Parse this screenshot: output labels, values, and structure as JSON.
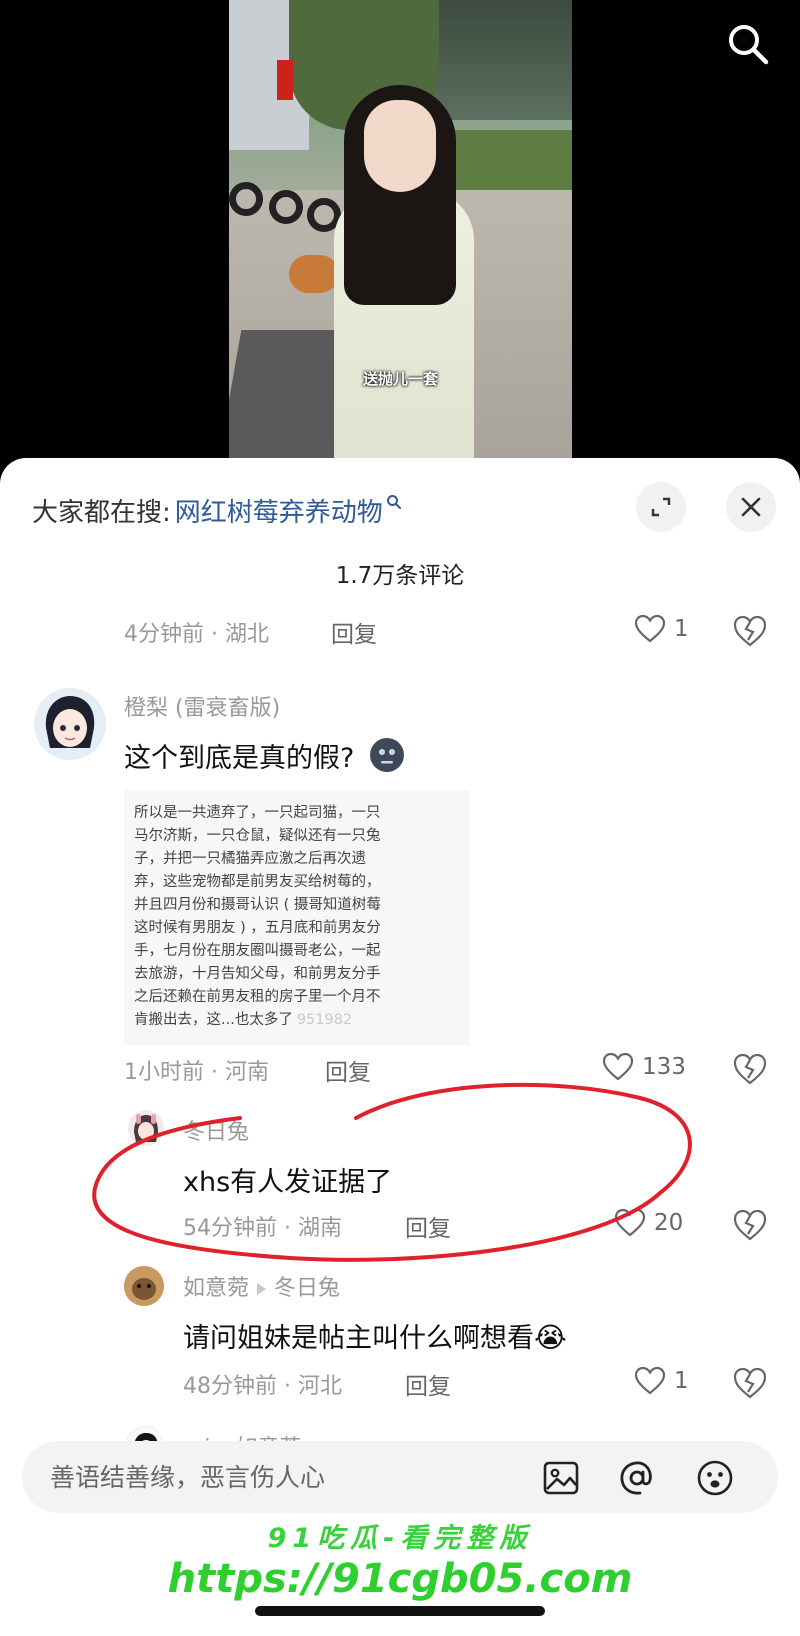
{
  "video": {
    "caption": "送抛儿一套"
  },
  "header": {
    "search_prefix": "大家都在搜:",
    "search_term": "网红树莓弃养动物",
    "comment_count": "1.7万条评论"
  },
  "comments": [
    {
      "meta": "4分钟前 · 湖北",
      "reply_label": "回复",
      "likes": "1"
    },
    {
      "author": "橙梨 (雷衰畜版)",
      "text": "这个到底是真的假?",
      "screenshot_lines": [
        "所以是一共遗弃了，一只起司猫，一只",
        "马尔济斯，一只仓鼠，疑似还有一只兔",
        "子，并把一只橘猫弄应激之后再次遗",
        "弃，这些宠物都是前男友买给树莓的，",
        "并且四月份和摄哥认识 ( 摄哥知道树莓",
        "这时候有男朋友 ) ，五月底和前男友分",
        "手，七月份在朋友圈叫摄哥老公，一起",
        "去旅游，十月告知父母，和前男友分手",
        "之后还赖在前男友租的房子里一个月不",
        "肯搬出去，这...也太多了"
      ],
      "screenshot_watermark": "951982",
      "meta": "1小时前 · 河南",
      "reply_label": "回复",
      "likes": "133"
    },
    {
      "author": "冬日兔",
      "text": "xhs有人发证据了",
      "meta": "54分钟前 · 湖南",
      "reply_label": "回复",
      "likes": "20"
    },
    {
      "author": "如意菀",
      "reply_to": "冬日兔",
      "text": "请问姐妹是帖主叫什么啊想看",
      "emoji": "😭",
      "meta": "48分钟前 · 河北",
      "reply_label": "回复",
      "likes": "1"
    },
    {
      "author": "mi",
      "reply_to": "如意菀"
    }
  ],
  "input": {
    "placeholder": "善语结善缘，恶言伤人心"
  },
  "watermark": {
    "line1": "91吃瓜-看完整版",
    "line2": "https://91cgb05.com"
  },
  "colors": {
    "search_term": "#2e5b98",
    "highlight_ring": "#e0202a",
    "watermark": "#2ecf2e"
  }
}
